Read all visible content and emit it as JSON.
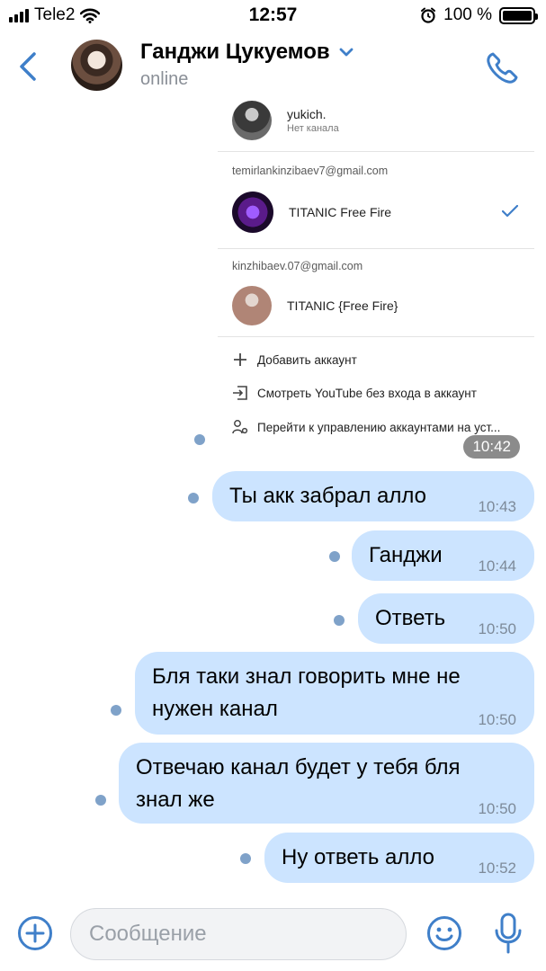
{
  "status_bar": {
    "carrier": "Tele2",
    "time": "12:57",
    "battery": "100 %",
    "battery_level": 1.0
  },
  "header": {
    "contact_name": "Ганджи Цукуемов",
    "status": "online"
  },
  "shared_screenshot": {
    "accounts": [
      {
        "title": "yukich.",
        "subtitle": "Нет канала"
      },
      {
        "email": "temirlankinzibaev7@gmail.com",
        "title": "TITANIC Free Fire",
        "selected": true
      },
      {
        "email": "kinzhibaev.07@gmail.com",
        "title": "TITANIC {Free Fire}"
      }
    ],
    "menu": [
      {
        "icon": "plus-icon",
        "label": "Добавить аккаунт"
      },
      {
        "icon": "signout-icon",
        "label": "Смотреть YouTube без входа в аккаунт"
      },
      {
        "icon": "manage-accounts-icon",
        "label": "Перейти к управлению аккаунтами на уст..."
      }
    ],
    "time": "10:42"
  },
  "messages": [
    {
      "text": "Ты акк забрал алло",
      "time": "10:43"
    },
    {
      "text": "Ганджи",
      "time": "10:44"
    },
    {
      "text": "Ответь",
      "time": "10:50"
    },
    {
      "text_lines": [
        "Бля таки знал говорить мне не",
        "нужен канал"
      ],
      "time": "10:50"
    },
    {
      "text_lines": [
        "Отвечаю канал будет у тебя бля",
        "знал же"
      ],
      "time": "10:50"
    },
    {
      "text": "Ну ответь алло",
      "time": "10:52"
    }
  ],
  "input": {
    "placeholder": "Сообщение"
  },
  "colors": {
    "accent": "#3f7fc9",
    "bubble": "#cce4ff",
    "unread_dot": "#7fa2c9"
  }
}
